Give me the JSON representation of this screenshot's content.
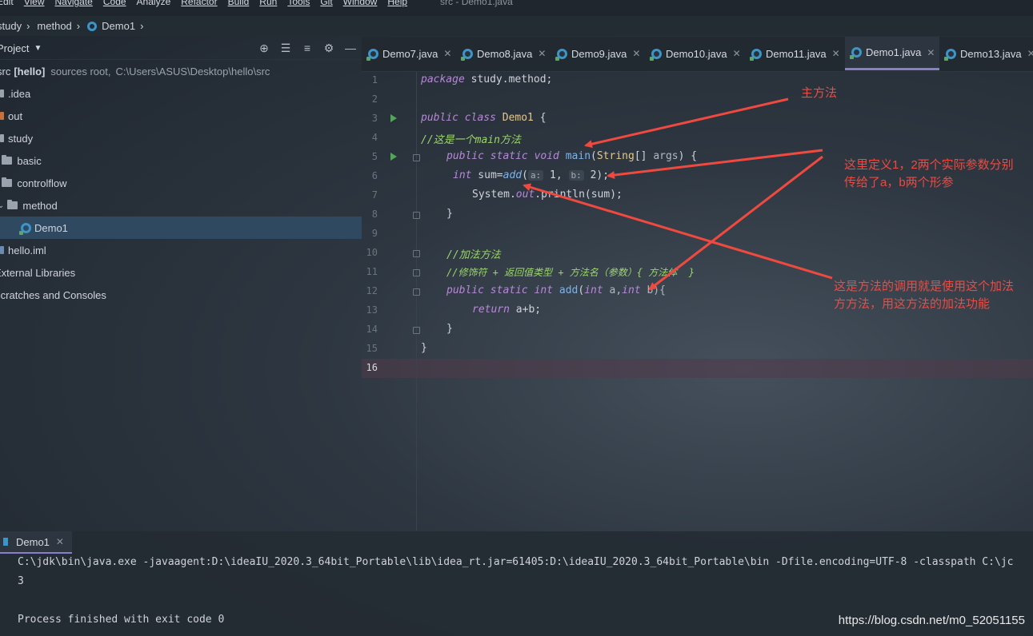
{
  "menu": {
    "items": [
      "Edit",
      "View",
      "Navigate",
      "Code",
      "Analyze",
      "Refactor",
      "Build",
      "Run",
      "Tools",
      "Git",
      "Window",
      "Help"
    ],
    "window_title": "src - Demo1.java"
  },
  "breadcrumb": {
    "items": [
      "study",
      "method",
      "Demo1"
    ]
  },
  "project": {
    "title": "Project",
    "root": {
      "name": "src",
      "module": "[hello]",
      "info": "sources root,",
      "path": "C:\\Users\\ASUS\\Desktop\\hello\\src"
    },
    "items": [
      ".idea",
      "out",
      "study",
      "basic",
      "controlflow",
      "method",
      "Demo1",
      "hello.iml",
      "External Libraries",
      "Scratches and Consoles"
    ]
  },
  "tabs": [
    "Demo7.java",
    "Demo8.java",
    "Demo9.java",
    "Demo10.java",
    "Demo11.java",
    "Demo1.java",
    "Demo13.java"
  ],
  "editor": {
    "line_numbers": [
      "1",
      "2",
      "3",
      "4",
      "5",
      "6",
      "7",
      "8",
      "9",
      "10",
      "11",
      "12",
      "13",
      "14",
      "15",
      "16"
    ],
    "code": {
      "l1_kw": "package",
      "l1_rest": " study.method;",
      "l3_kw": "public class",
      "l3_cls": " Demo1",
      "l3_rest": " {",
      "l4": "//这是一个main方法",
      "l5_kw": "public static void",
      "l5_fn": " main",
      "l5_p1": "(",
      "l5_cls": "String",
      "l5_p2": "[] ",
      "l5_param": "args",
      "l5_p3": ") {",
      "l6_kw": "int",
      "l6_a": " sum=",
      "l6_fn": "add",
      "l6_b": "(",
      "l6_hint_a": "a:",
      "l6_va": " 1, ",
      "l6_hint_b": "b:",
      "l6_vb": " 2);",
      "l7_a": "System.",
      "l7_field": "out",
      "l7_b": ".println(sum);",
      "l8": "}",
      "l10": "//加法方法",
      "l11": "//修饰符 + 返回值类型 + 方法名（参数）{ 方法体  }",
      "l12_kw": "public static int",
      "l12_fn": " add",
      "l12_a": "(",
      "l12_kw2": "int",
      "l12_b": " a,",
      "l12_kw3": "int",
      "l12_c": " b){",
      "l13_kw": "return",
      "l13_rest": " a+b;",
      "l14": "}",
      "l15": "}"
    }
  },
  "annotations": {
    "main_method": "主方法",
    "actual_params_1": "这里定义1，2两个实际参数分别",
    "actual_params_2": "传给了a，b两个形参",
    "call_1": "这是方法的调用就是使用这个加法",
    "call_2": "方方法，用这方法的加法功能"
  },
  "run_panel": {
    "tab": "Demo1",
    "lines": [
      "C:\\jdk\\bin\\java.exe -javaagent:D:\\ideaIU_2020.3_64bit_Portable\\lib\\idea_rt.jar=61405:D:\\ideaIU_2020.3_64bit_Portable\\bin -Dfile.encoding=UTF-8 -classpath C:\\jc",
      "3",
      "Process finished with exit code 0"
    ]
  },
  "watermark": "https://blog.csdn.net/m0_52051155",
  "colors": {
    "accent": "#8a7fc7",
    "annotation": "#f0493f",
    "keyword": "#b789d8",
    "comment": "#9bd66a"
  }
}
